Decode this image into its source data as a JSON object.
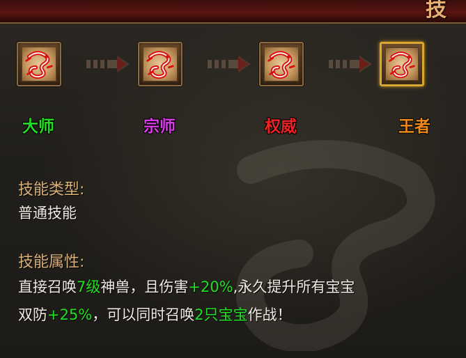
{
  "header": {
    "title": "技"
  },
  "stages": [
    {
      "label": "大师",
      "color": "#22dd22",
      "icon": "red-dragon-icon"
    },
    {
      "label": "宗师",
      "color": "#d83ae8",
      "icon": "red-dragon-icon"
    },
    {
      "label": "权威",
      "color": "#ee2222",
      "icon": "red-dragon-icon"
    },
    {
      "label": "王者",
      "color": "#f08a1a",
      "icon": "red-dragon-icon",
      "selected": true
    }
  ],
  "skill_type": {
    "heading": "技能类型:",
    "value": "普通技能"
  },
  "skill_attr": {
    "heading": "技能属性:",
    "line1": {
      "p1": "直接召唤",
      "h1": "7级",
      "p2": "神兽，且伤害",
      "h2": "+20%",
      "p3": ",永久提升所有宝宝"
    },
    "line2": {
      "p1": "双防",
      "h1": "+25%",
      "p2": "，可以同时召唤",
      "h2": "2只宝宝",
      "p3": "作战！"
    }
  },
  "colors": {
    "highlight": "#22e022",
    "heading": "#d8b078",
    "selected_border": "#d8a830"
  }
}
